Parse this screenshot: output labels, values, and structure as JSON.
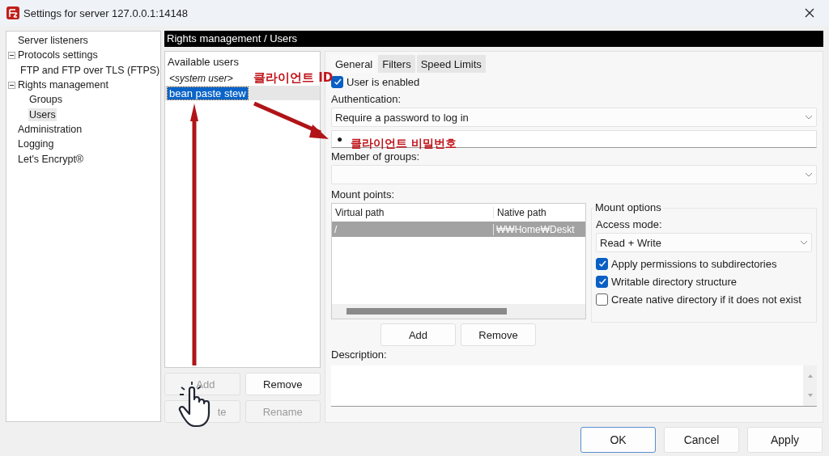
{
  "window": {
    "title": "Settings for server 127.0.0.1:14148"
  },
  "tree": [
    {
      "label": "Server listeners",
      "selected": false
    },
    {
      "label": "Protocols settings",
      "expanded": true,
      "selected": false,
      "children": [
        {
          "label": "FTP and FTP over TLS (FTPS)",
          "selected": false
        }
      ]
    },
    {
      "label": "Rights management",
      "expanded": true,
      "selected": false,
      "children": [
        {
          "label": "Groups",
          "selected": false
        },
        {
          "label": "Users",
          "selected": true
        }
      ]
    },
    {
      "label": "Administration",
      "selected": false
    },
    {
      "label": "Logging",
      "selected": false
    },
    {
      "label": "Let's Encrypt®",
      "selected": false
    }
  ],
  "page_header": "Rights management / Users",
  "users": {
    "label": "Available users",
    "items": [
      {
        "name": "<system user>",
        "kind": "system",
        "selected": false
      },
      {
        "name": "bean paste stew",
        "kind": "user",
        "selected": true
      }
    ],
    "buttons": [
      {
        "label": "Add",
        "disabled": true
      },
      {
        "label": "Remove",
        "disabled": false
      },
      {
        "label": "te",
        "disabled": true
      },
      {
        "label": "Rename",
        "disabled": true
      }
    ]
  },
  "tabs": [
    {
      "label": "General",
      "selected": true
    },
    {
      "label": "Filters",
      "selected": false
    },
    {
      "label": "Speed Limits",
      "selected": false
    }
  ],
  "general": {
    "enabled": {
      "label": "User is enabled",
      "checked": true
    },
    "auth_label": "Authentication:",
    "auth_value": "Require a password to log in",
    "password": "●",
    "groups_label": "Member of groups:",
    "mount_label": "Mount points:",
    "mount_columns": [
      "Virtual path",
      "Native path"
    ],
    "mount_rows": [
      {
        "virtual": "/",
        "native": "₩₩Home₩Deskt",
        "selected": true
      }
    ],
    "mount_options": {
      "title": "Mount options",
      "access_label": "Access mode:",
      "access_value": "Read + Write",
      "checks": [
        {
          "label": "Apply permissions to subdirectories",
          "checked": true
        },
        {
          "label": "Writable directory structure",
          "checked": true
        },
        {
          "label": "Create native directory if it does not exist",
          "checked": false
        }
      ]
    },
    "mount_buttons": [
      "Add",
      "Remove"
    ],
    "description_label": "Description:"
  },
  "dialog_buttons": [
    {
      "label": "OK",
      "default": true
    },
    {
      "label": "Cancel",
      "default": false
    },
    {
      "label": "Apply",
      "default": false
    }
  ],
  "annotations": [
    {
      "kind": "label",
      "text": "클라이언트 ID"
    },
    {
      "kind": "label",
      "text": "클라이언트 비밀번호"
    }
  ]
}
